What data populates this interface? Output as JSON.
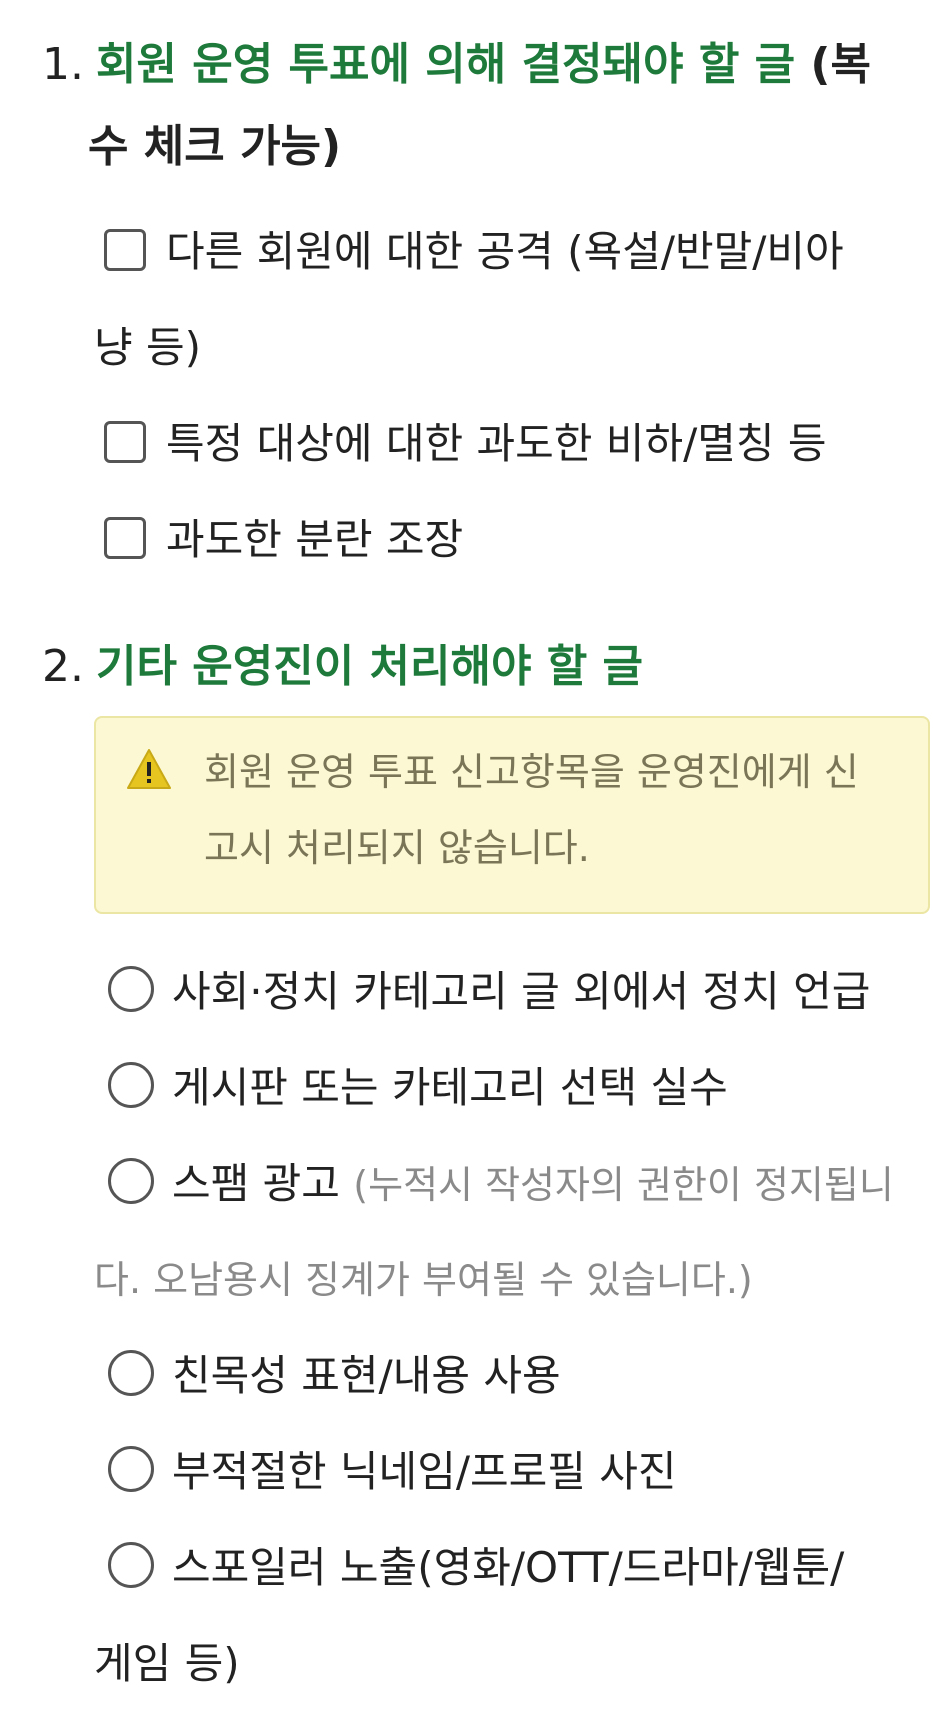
{
  "section1": {
    "number": "1.",
    "accent_title": "회원 운영 투표에 의해 결정돼야 할 글",
    "title_suffix_line1": "(복",
    "title_suffix_line2": "수 체크 가능)",
    "options": [
      {
        "line1": "다른 회원에 대한 공격 (욕설/반말/비아",
        "line2": "냥 등)"
      },
      {
        "line1": "특정 대상에 대한 과도한 비하/멸칭 등"
      },
      {
        "line1": "과도한 분란 조장"
      }
    ]
  },
  "section2": {
    "number": "2.",
    "accent_title": "기타 운영진이 처리해야 할 글",
    "notice": {
      "icon": "warning-icon",
      "line1": "회원 운영 투표 신고항목을 운영진에게 신",
      "line2": "고시 처리되지 않습니다."
    },
    "options": [
      {
        "label": "사회·정치 카테고리 글 외에서 정치 언급"
      },
      {
        "label": "게시판 또는 카테고리 선택 실수"
      },
      {
        "label": "스팸 광고",
        "note_line1": "(누적시 작성자의 권한이 정지됩니",
        "note_line2": "다. 오남용시 징계가 부여될 수 있습니다.)"
      },
      {
        "label": "친목성 표현/내용 사용"
      },
      {
        "label": "부적절한 닉네임/프로필 사진"
      },
      {
        "label": "스포일러 노출(영화/OTT/드라마/웹툰/",
        "label_line2": "게임 등)"
      }
    ]
  },
  "colors": {
    "accent_green": "#1d7a3a",
    "notice_bg": "#fbf8d3",
    "notice_border": "#ece6a4",
    "warning_yellow": "#e6c520"
  }
}
